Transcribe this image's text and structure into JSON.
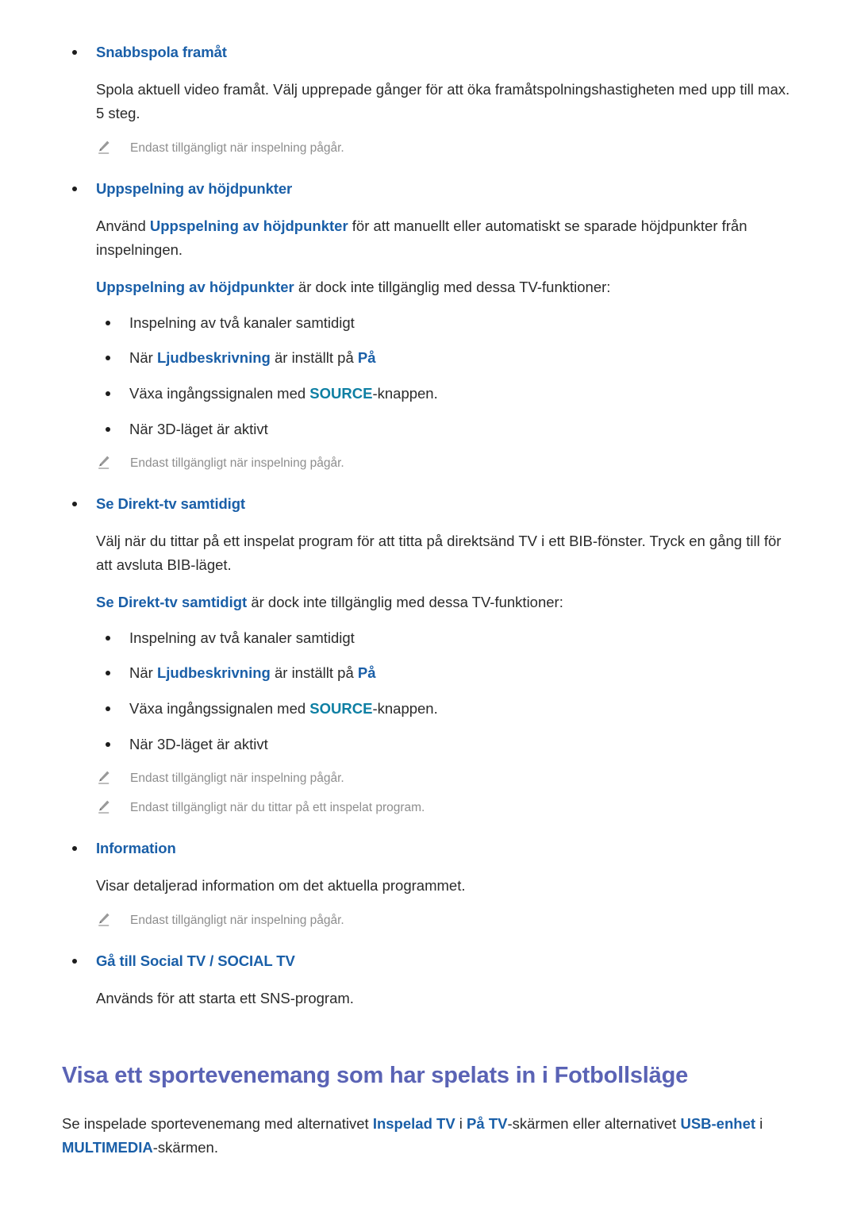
{
  "colors": {
    "keyword_blue": "#1a5fa8",
    "keyword_teal": "#0d7fa3",
    "section_heading": "#5a63b5",
    "body_text": "#2b2b2b",
    "note_text": "#8e8e8e",
    "background": "#ffffff"
  },
  "icons": {
    "note": "pencil-icon",
    "bullet": "bullet-dot"
  },
  "features": [
    {
      "title": "Snabbspola framåt",
      "paragraph": "Spola aktuell video framåt. Välj upprepade gånger för att öka framåtspolningshastigheten med upp till max. 5 steg.",
      "notes": [
        "Endast tillgängligt när inspelning pågår."
      ]
    },
    {
      "title": "Uppspelning av höjdpunkter",
      "paragraph_parts": {
        "p1": "Använd ",
        "kw1": "Uppspelning av höjdpunkter",
        "p2": " för att manuellt eller automatiskt se sparade höjdpunkter från inspelningen."
      },
      "restriction_intro": {
        "kw": "Uppspelning av höjdpunkter",
        "text": " är dock inte tillgänglig med dessa TV-funktioner:"
      },
      "restrictions": [
        {
          "text": "Inspelning av två kanaler samtidigt"
        },
        {
          "pre": "När ",
          "kw": "Ljudbeskrivning",
          "mid": " är inställt på ",
          "kw2": "På",
          "post": ""
        },
        {
          "pre": "Växa ingångssignalen med ",
          "kw_teal": "SOURCE",
          "post": "-knappen."
        },
        {
          "text": "När 3D-läget är aktivt"
        }
      ],
      "notes": [
        "Endast tillgängligt när inspelning pågår."
      ]
    },
    {
      "title": "Se Direkt-tv samtidigt",
      "paragraph": "Välj när du tittar på ett inspelat program för att titta på direktsänd TV i ett BIB-fönster. Tryck en gång till för att avsluta BIB-läget.",
      "restriction_intro": {
        "kw": "Se Direkt-tv samtidigt",
        "text": " är dock inte tillgänglig med dessa TV-funktioner:"
      },
      "restrictions": [
        {
          "text": "Inspelning av två kanaler samtidigt"
        },
        {
          "pre": "När ",
          "kw": "Ljudbeskrivning",
          "mid": " är inställt på ",
          "kw2": "På",
          "post": ""
        },
        {
          "pre": "Växa ingångssignalen med ",
          "kw_teal": "SOURCE",
          "post": "-knappen."
        },
        {
          "text": "När 3D-läget är aktivt"
        }
      ],
      "notes": [
        "Endast tillgängligt när inspelning pågår.",
        "Endast tillgängligt när du tittar på ett inspelat program."
      ]
    },
    {
      "title": "Information",
      "paragraph": "Visar detaljerad information om det aktuella programmet.",
      "notes": [
        "Endast tillgängligt när inspelning pågår."
      ]
    },
    {
      "title_parts": {
        "a": "Gå till Social TV",
        "sep": " / ",
        "b": "SOCIAL TV"
      },
      "paragraph": "Används för att starta ett SNS-program.",
      "notes": []
    }
  ],
  "section": {
    "heading": "Visa ett sportevenemang som har spelats in i Fotbollsläge",
    "lead": {
      "p1": "Se inspelade sportevenemang med alternativet ",
      "kw1": "Inspelad TV",
      "p2": " i ",
      "kw2": "På TV",
      "p3": "-skärmen eller alternativet ",
      "kw3": "USB-enhet",
      "p4": " i ",
      "kw4": "MULTIMEDIA",
      "p5": "-skärmen."
    }
  }
}
